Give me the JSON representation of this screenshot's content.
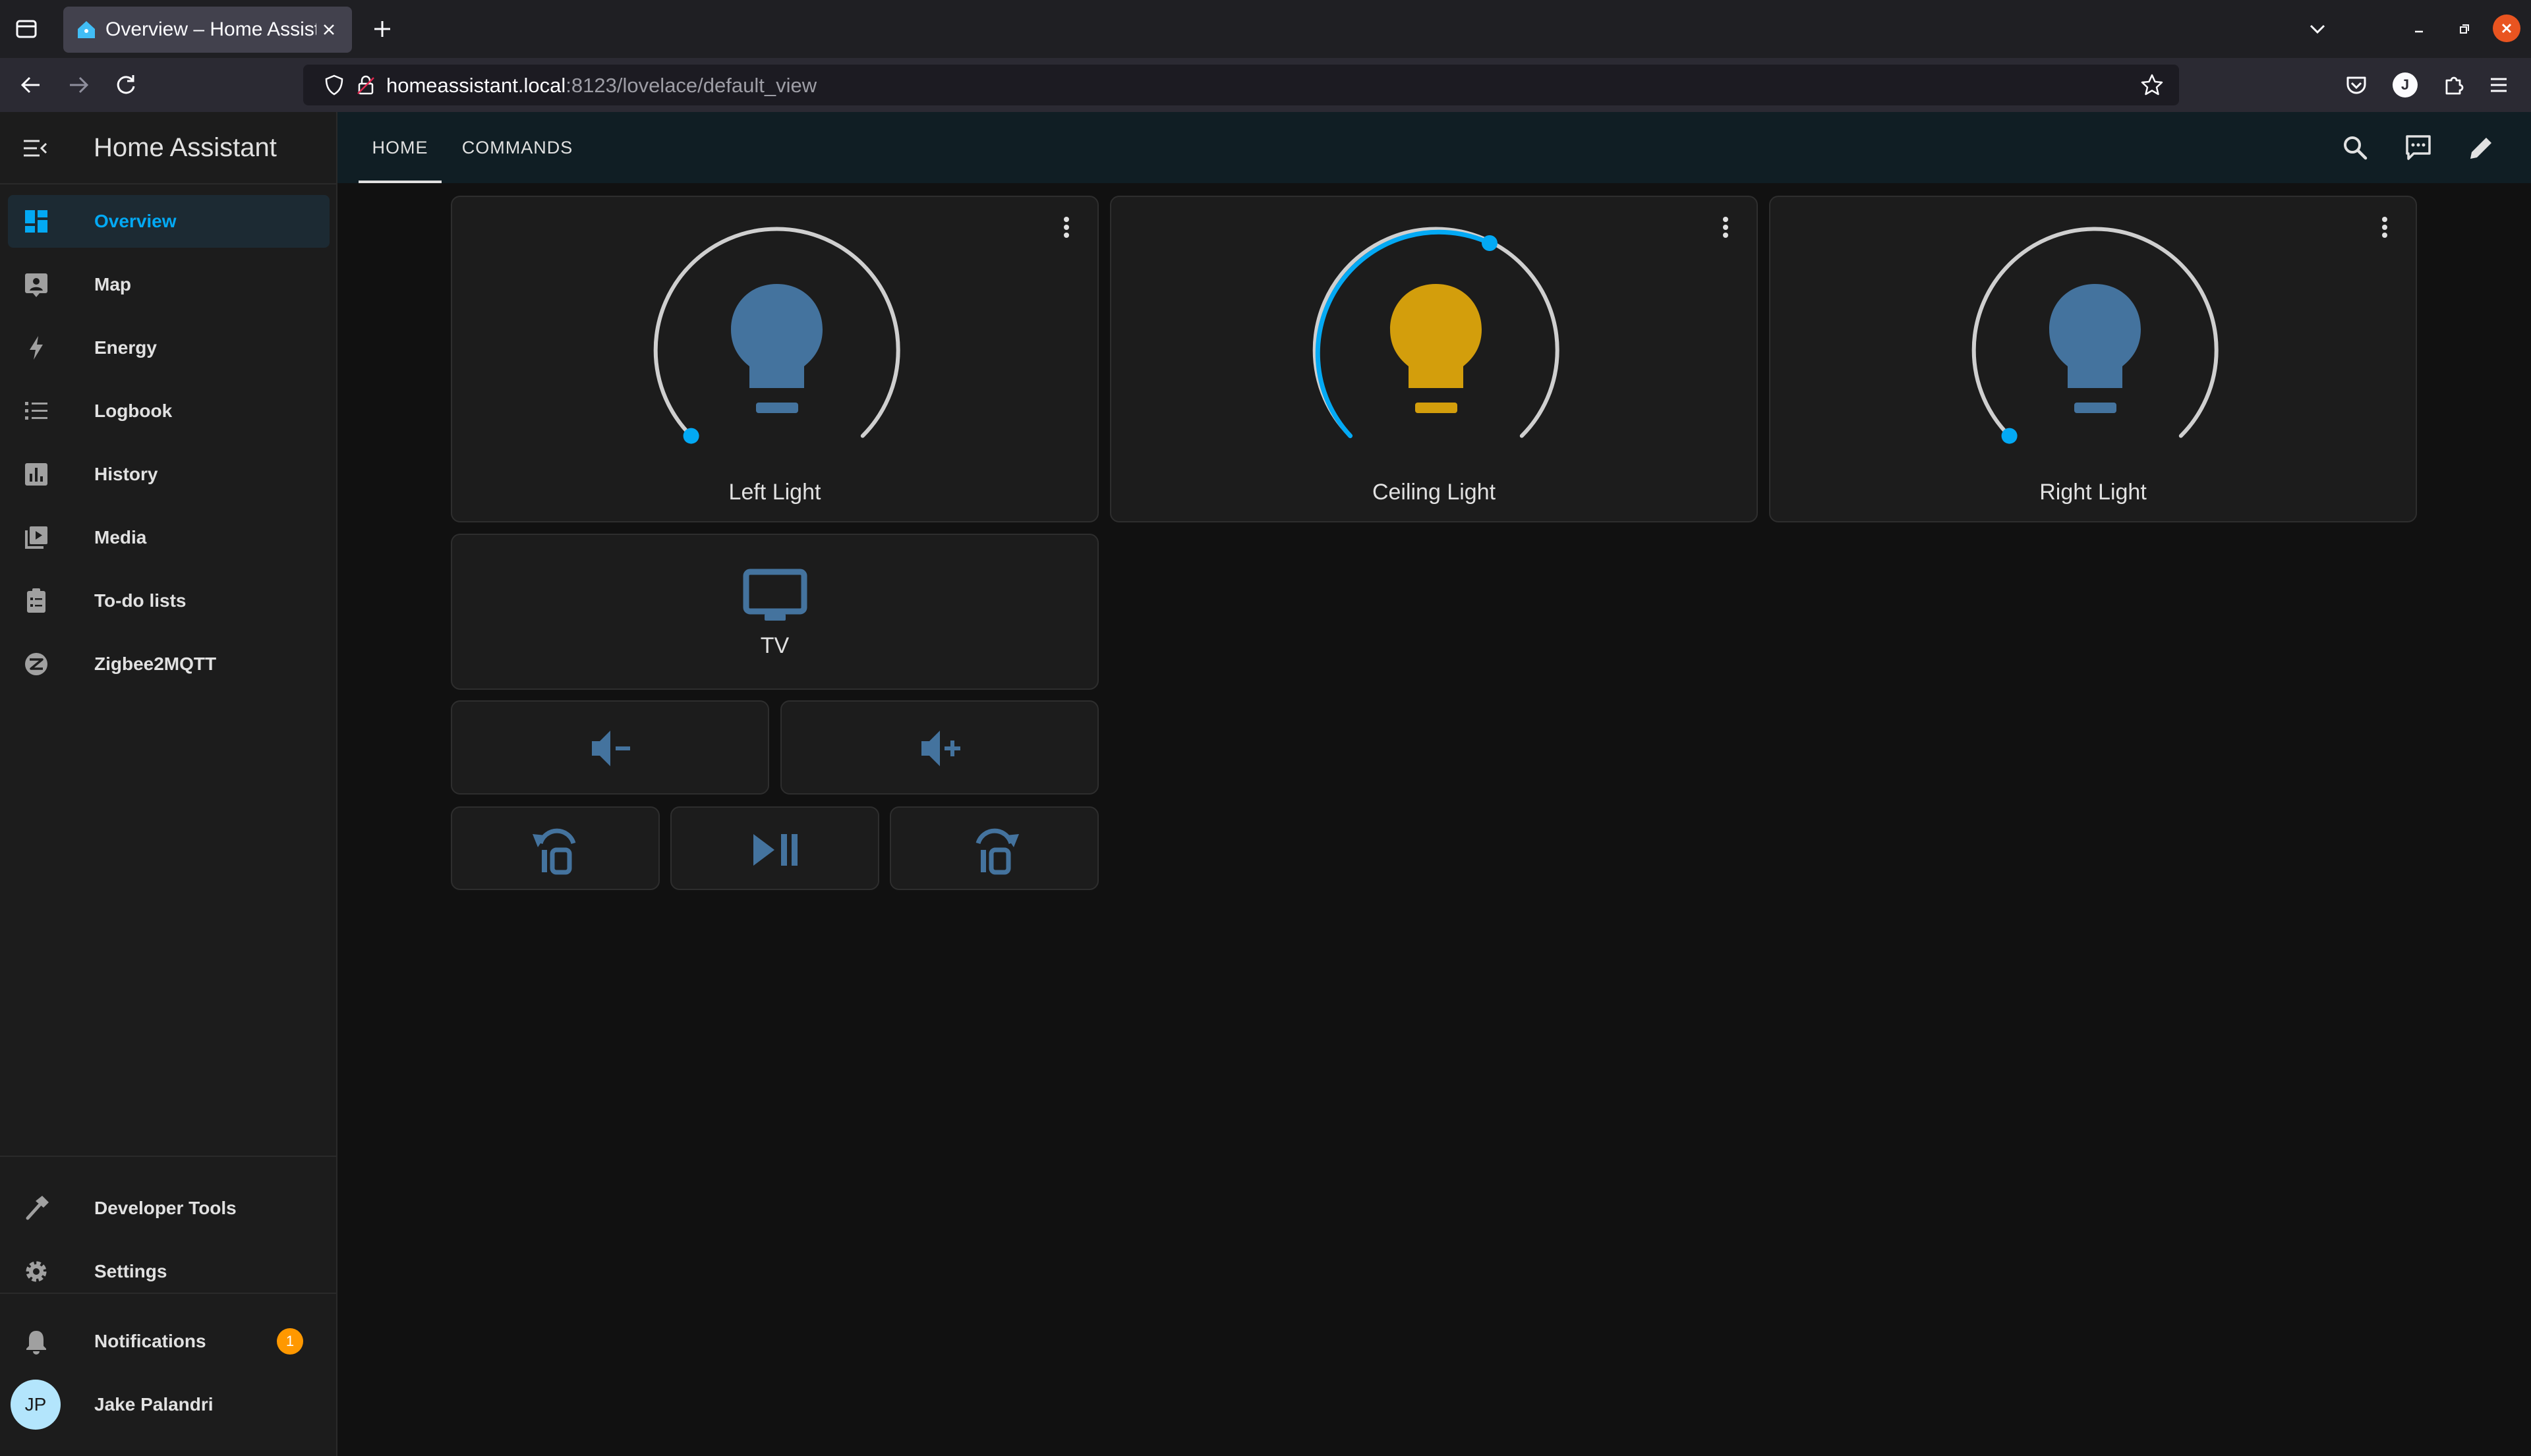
{
  "browser": {
    "tab_title": "Overview – Home Assist",
    "url_host": "homeassistant.local",
    "url_rest": ":8123/lovelace/default_view",
    "profile_initial": "J"
  },
  "sidebar": {
    "title": "Home Assistant",
    "items": [
      {
        "label": "Overview",
        "icon": "dashboard-icon",
        "active": true
      },
      {
        "label": "Map",
        "icon": "map-icon"
      },
      {
        "label": "Energy",
        "icon": "lightning-bolt-icon"
      },
      {
        "label": "Logbook",
        "icon": "logbook-list-icon"
      },
      {
        "label": "History",
        "icon": "history-chart-icon"
      },
      {
        "label": "Media",
        "icon": "media-play-icon"
      },
      {
        "label": "To-do lists",
        "icon": "clipboard-list-icon"
      },
      {
        "label": "Zigbee2MQTT",
        "icon": "zigbee-icon"
      }
    ],
    "developer_tools": "Developer Tools",
    "settings": "Settings",
    "notifications": "Notifications",
    "notifications_count": "1",
    "user_name": "Jake Palandri",
    "user_initials": "JP"
  },
  "appbar": {
    "tabs": [
      {
        "label": "HOME",
        "active": true
      },
      {
        "label": "COMMANDS",
        "active": false
      }
    ]
  },
  "lights": [
    {
      "name": "Left Light",
      "state": "off",
      "brightness": 0,
      "color": "#44739e"
    },
    {
      "name": "Ceiling Light",
      "state": "on",
      "brightness": 0.58,
      "color": "#d39e0c"
    },
    {
      "name": "Right Light",
      "state": "off",
      "brightness": 0,
      "color": "#44739e"
    }
  ],
  "tv": {
    "name": "TV",
    "icon": "television-icon"
  },
  "controls": {
    "volume": [
      "volume-minus-icon",
      "volume-plus-icon"
    ],
    "playback": [
      "rewind-10-icon",
      "play-pause-icon",
      "fast-forward-10-icon"
    ]
  },
  "colors": {
    "accent": "#03a9f4",
    "icon_off": "#44739e",
    "icon_on": "#d39e0c",
    "badge": "#ff9800"
  }
}
